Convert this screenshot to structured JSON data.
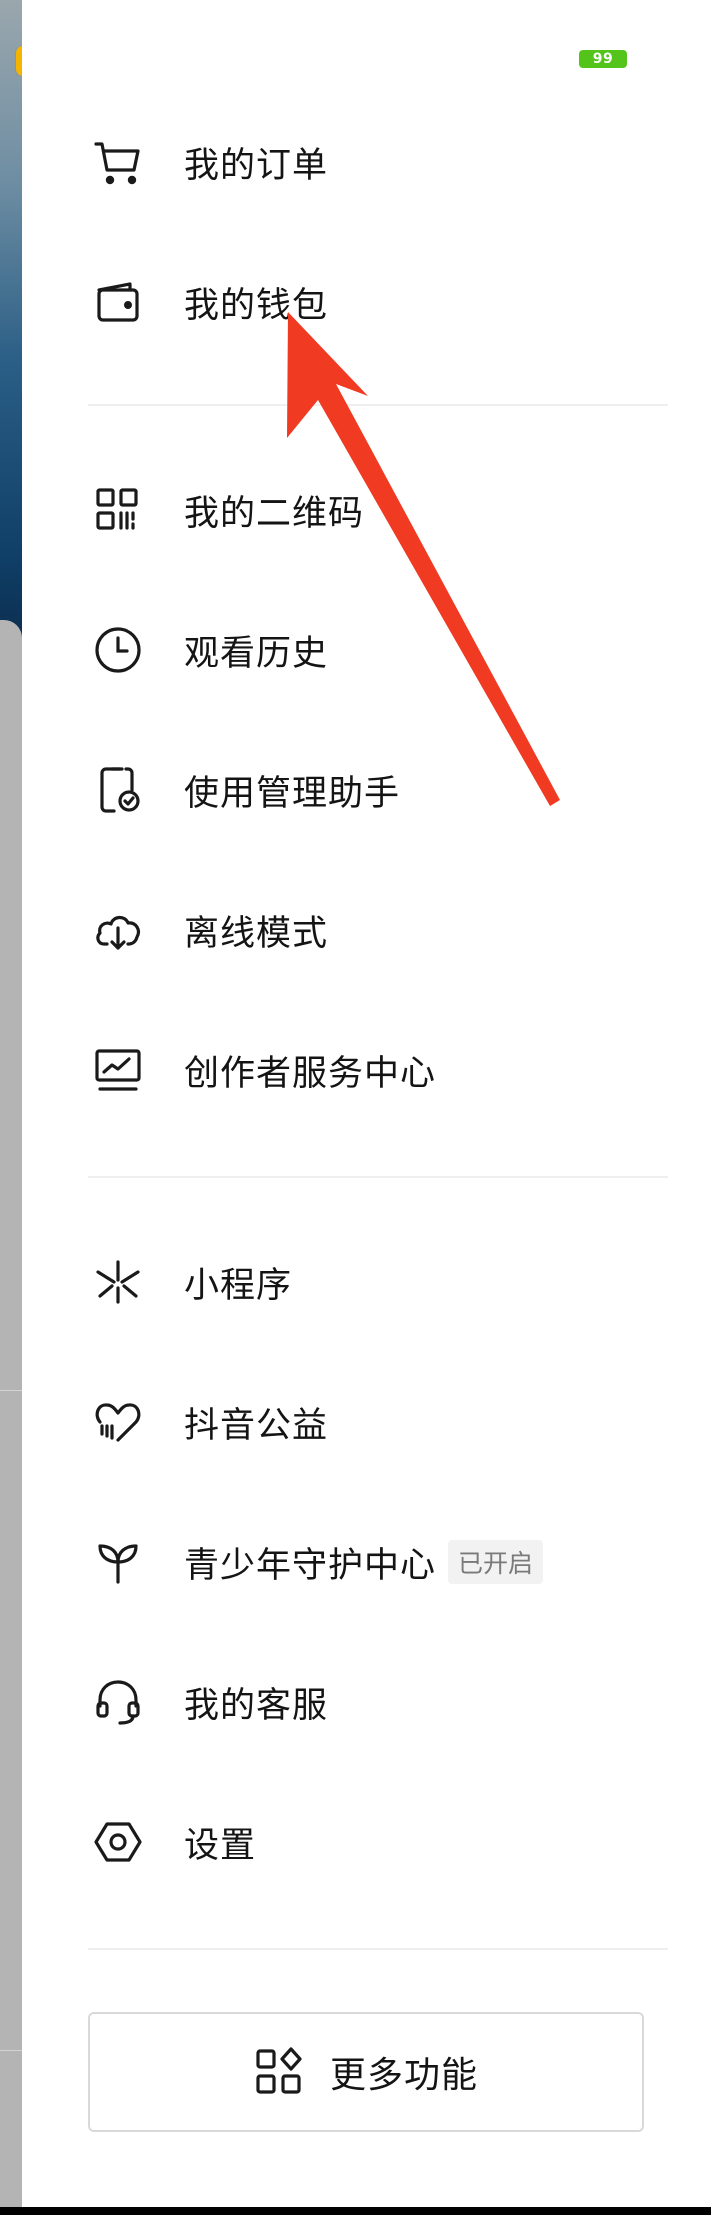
{
  "status": {
    "battery": "99"
  },
  "menu": {
    "group1": [
      {
        "label": "我的订单",
        "icon": "cart-icon"
      },
      {
        "label": "我的钱包",
        "icon": "wallet-icon"
      }
    ],
    "group2": [
      {
        "label": "我的二维码",
        "icon": "qr-code-icon"
      },
      {
        "label": "观看历史",
        "icon": "clock-icon"
      },
      {
        "label": "使用管理助手",
        "icon": "phone-check-icon"
      },
      {
        "label": "离线模式",
        "icon": "cloud-download-icon"
      },
      {
        "label": "创作者服务中心",
        "icon": "monitor-chart-icon"
      }
    ],
    "group3": [
      {
        "label": "小程序",
        "icon": "mini-program-icon"
      },
      {
        "label": "抖音公益",
        "icon": "heart-charity-icon"
      },
      {
        "label": "青少年守护中心",
        "icon": "sprout-icon",
        "tag": "已开启"
      },
      {
        "label": "我的客服",
        "icon": "headset-icon"
      },
      {
        "label": "设置",
        "icon": "settings-hex-icon"
      }
    ]
  },
  "more_button": {
    "label": "更多功能",
    "icon": "grid-diamond-icon"
  },
  "colors": {
    "accent_arrow": "#f03a22",
    "battery": "#52c41a",
    "app_badge": "#f4b400"
  }
}
